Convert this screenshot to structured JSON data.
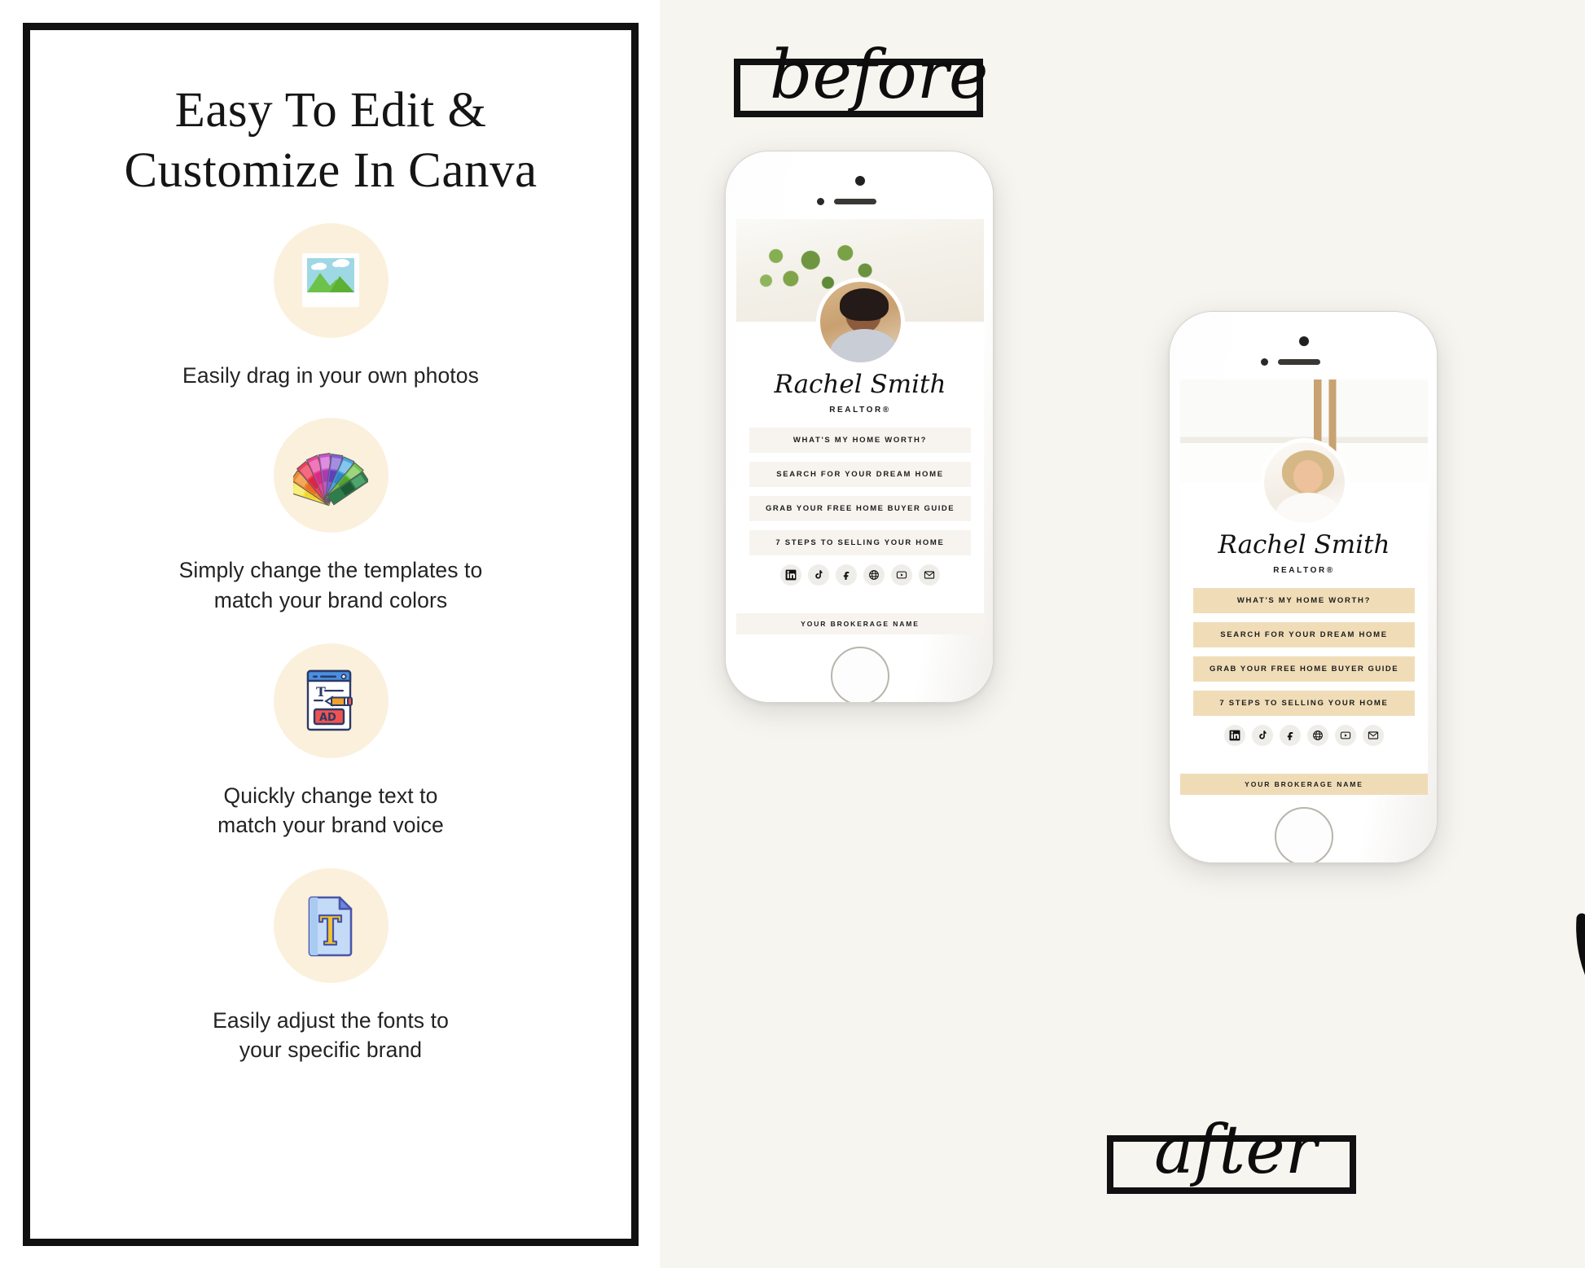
{
  "left": {
    "headline_line1": "Easy To Edit &",
    "headline_line2": "Customize In Canva",
    "features": [
      {
        "icon": "photo-landscape-icon",
        "text": "Easily drag in your own photos"
      },
      {
        "icon": "color-swatch-fan-icon",
        "text": "Simply change the templates to\nmatch your brand colors"
      },
      {
        "icon": "ad-editor-icon",
        "text": "Quickly change text to\nmatch your brand voice"
      },
      {
        "icon": "font-document-icon",
        "text": "Easily adjust the fonts to\nyour specific brand"
      }
    ]
  },
  "right": {
    "before_label": "before",
    "after_label": "after",
    "arrow": "curved-arrow-down-right-icon",
    "phones": [
      {
        "id": "before",
        "hero_image": "living-room-with-olive-branches",
        "avatar_image": "realtor-headshot-dark-hair",
        "name": "Rachel Smith",
        "role": "REALTOR®",
        "button_color": "#f7f4ef",
        "brokerage_color": "#f7f4ef",
        "buttons": [
          "WHAT'S MY HOME WORTH?",
          "SEARCH FOR YOUR DREAM HOME",
          "GRAB YOUR FREE HOME BUYER GUIDE",
          "7 STEPS TO SELLING YOUR HOME"
        ],
        "socials": [
          "linkedin-icon",
          "tiktok-icon",
          "facebook-icon",
          "globe-icon",
          "youtube-icon",
          "email-icon"
        ],
        "brokerage": "YOUR BROKERAGE NAME"
      },
      {
        "id": "after",
        "hero_image": "white-kitchen-interior",
        "avatar_image": "realtor-headshot-blonde-hair",
        "name": "Rachel Smith",
        "role": "REALTOR®",
        "button_color": "#f0ddb8",
        "brokerage_color": "#efdcb7",
        "buttons": [
          "WHAT'S MY HOME WORTH?",
          "SEARCH FOR YOUR DREAM HOME",
          "GRAB YOUR FREE HOME BUYER GUIDE",
          "7 STEPS TO SELLING YOUR HOME"
        ],
        "socials": [
          "linkedin-icon",
          "tiktok-icon",
          "facebook-icon",
          "globe-icon",
          "youtube-icon",
          "email-icon"
        ],
        "brokerage": "YOUR BROKERAGE NAME"
      }
    ]
  },
  "colors": {
    "panel_background": "#f7f5f0",
    "left_background": "#ffffff",
    "frame_border": "#111111",
    "icon_circle": "#fbf0dc",
    "accent_tan": "#f0ddb8",
    "neutral_button": "#f7f4ef",
    "text_dark": "#1c1c1c"
  }
}
